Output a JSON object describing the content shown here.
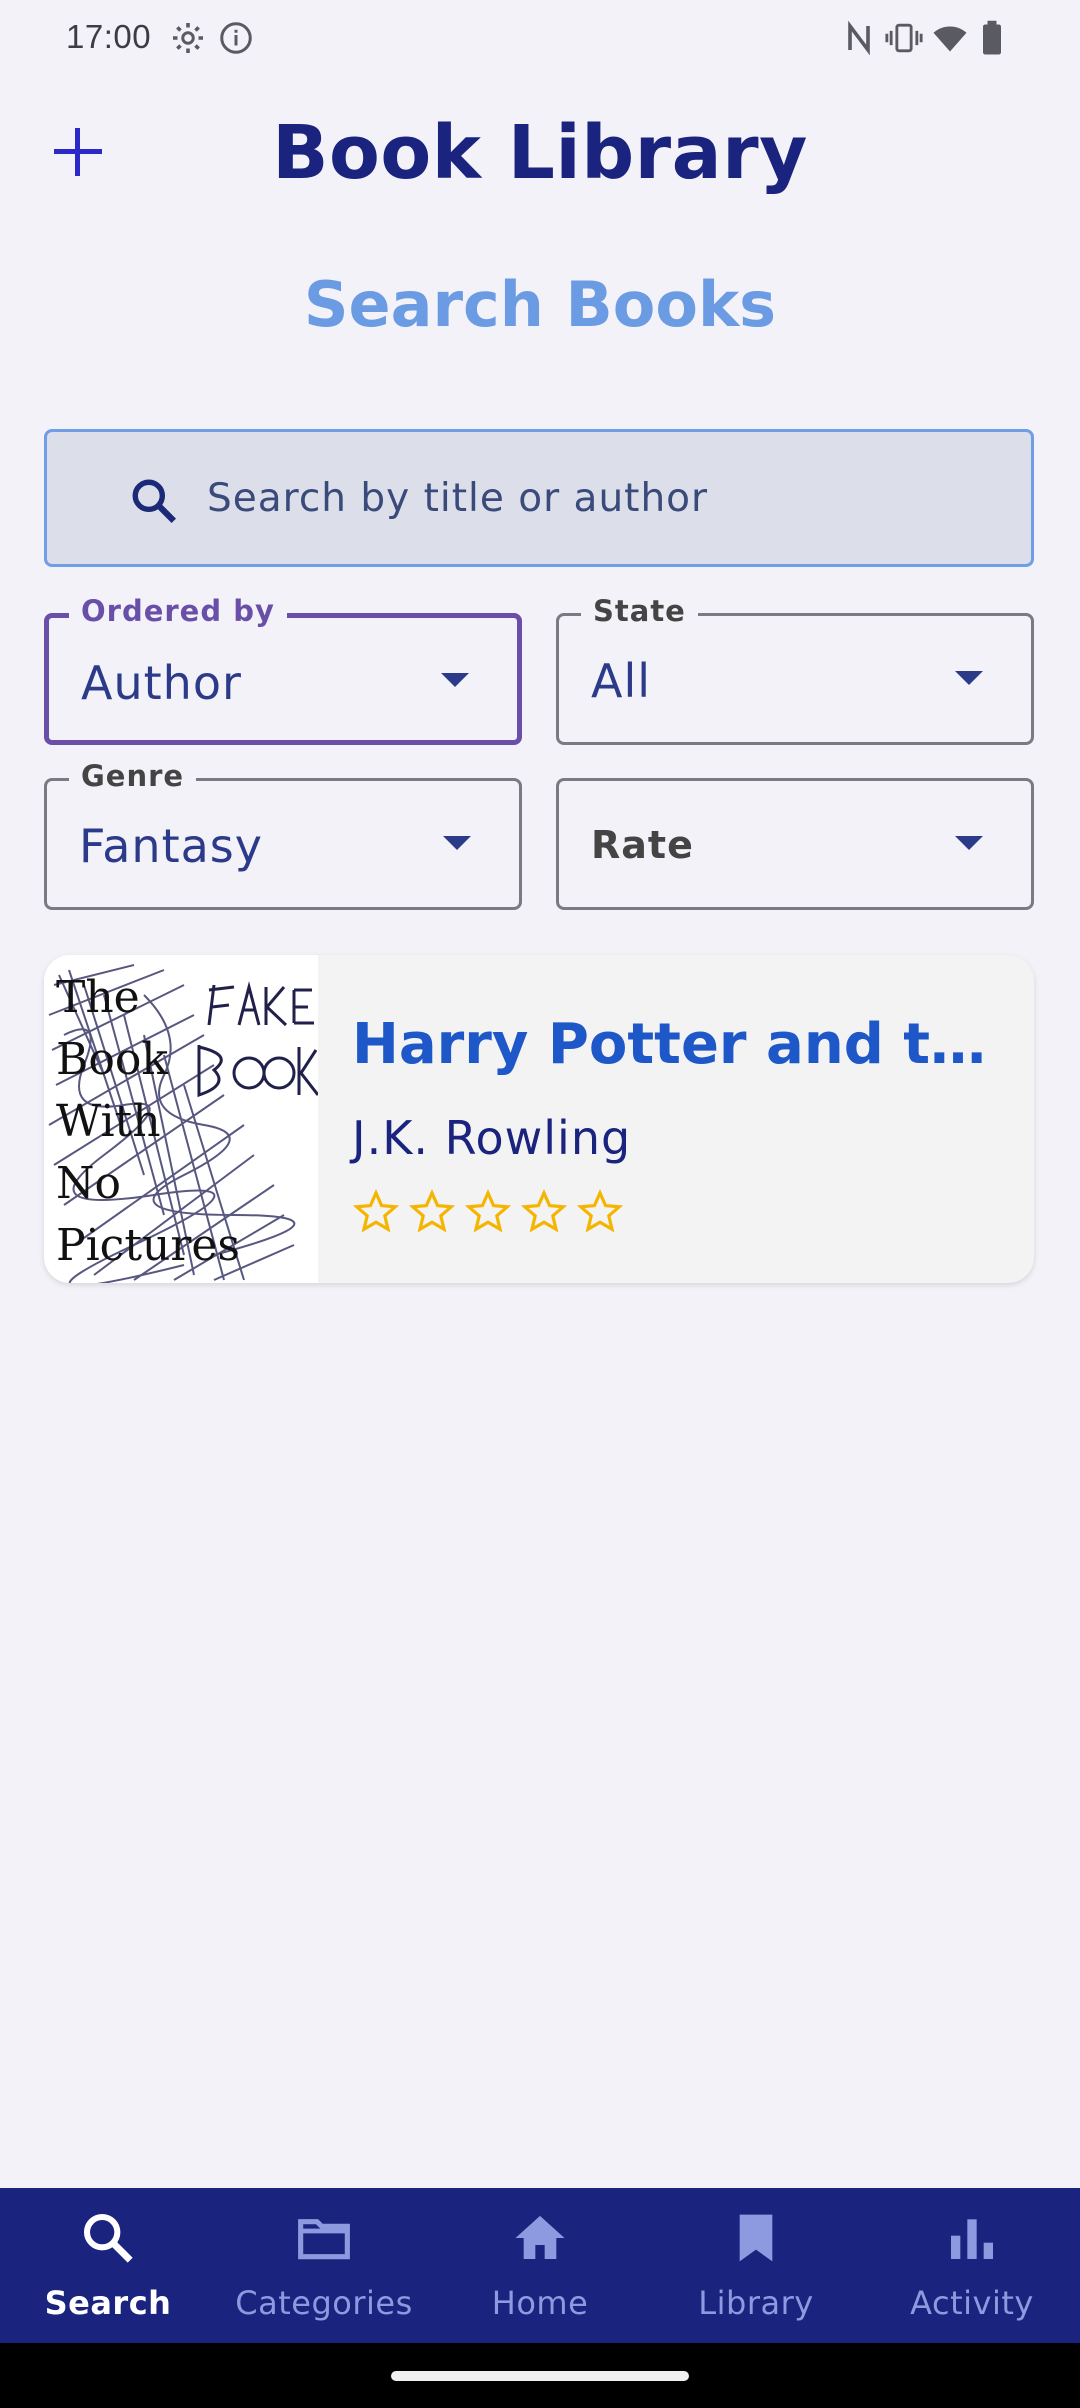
{
  "status_bar": {
    "time": "17:00",
    "left_icons": [
      "settings-icon",
      "info-icon"
    ],
    "right_icons": [
      "nfc-icon",
      "vibrate-icon",
      "wifi-icon",
      "battery-icon"
    ]
  },
  "header": {
    "title": "Book Library",
    "add_icon": "plus-icon"
  },
  "page": {
    "subtitle": "Search Books"
  },
  "search": {
    "placeholder": "Search by title or author",
    "value": "",
    "icon": "search-icon"
  },
  "filters": {
    "ordered_by": {
      "label": "Ordered by",
      "value": "Author"
    },
    "state": {
      "label": "State",
      "value": "All"
    },
    "genre": {
      "label": "Genre",
      "value": "Fantasy"
    },
    "rate": {
      "placeholder": "Rate"
    }
  },
  "results": [
    {
      "title": "Harry Potter and the ...",
      "author": "J.K. Rowling",
      "rating": 0,
      "rating_max": 5,
      "cover_text": [
        "The",
        "Book",
        "With",
        "No",
        "Pictures"
      ],
      "cover_scribble": "FAKE Book"
    }
  ],
  "colors": {
    "title": "#1a237e",
    "subtitle": "#6b9be3",
    "link": "#1e57c8",
    "nav_background": "#1a237e",
    "nav_inactive": "#8e9ae0",
    "star": "#f5b400",
    "active_outline": "#6a4fa8"
  },
  "bottom_nav": {
    "items": [
      {
        "label": "Search",
        "icon": "search-icon",
        "active": true
      },
      {
        "label": "Categories",
        "icon": "folder-icon",
        "active": false
      },
      {
        "label": "Home",
        "icon": "home-icon",
        "active": false
      },
      {
        "label": "Library",
        "icon": "bookmark-icon",
        "active": false
      },
      {
        "label": "Activity",
        "icon": "bar-chart-icon",
        "active": false
      }
    ]
  }
}
